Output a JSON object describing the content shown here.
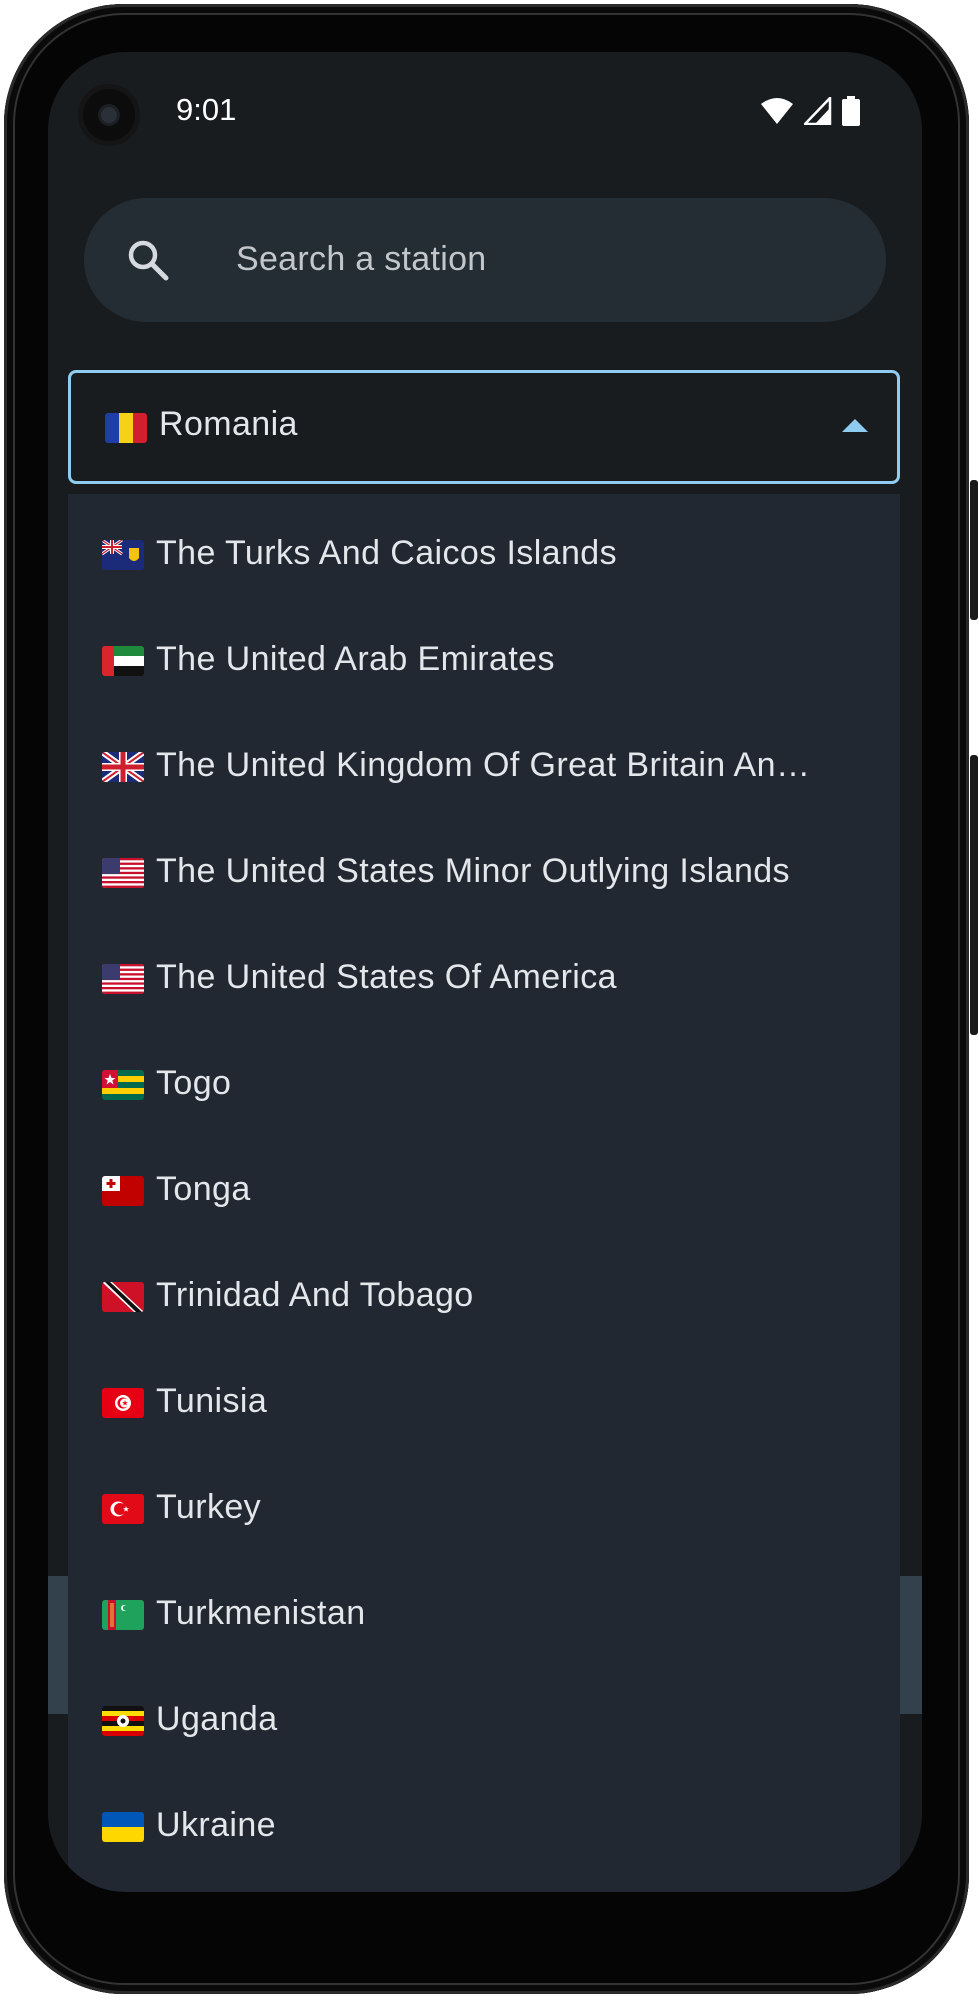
{
  "status_bar": {
    "time": "9:01",
    "icons": [
      "wifi-icon",
      "cellular-signal-icon",
      "battery-icon"
    ]
  },
  "search": {
    "placeholder": "Search a station",
    "icon": "search-icon"
  },
  "country_select": {
    "selected": "Romania",
    "selected_flag": "flag-romania-icon",
    "state": "expanded",
    "accent_color": "#8fcdf0"
  },
  "dropdown": {
    "items": [
      {
        "label": "The Turks And Caicos Islands",
        "flag": "flag-turks-caicos-icon"
      },
      {
        "label": "The United Arab Emirates",
        "flag": "flag-uae-icon"
      },
      {
        "label": "The United Kingdom Of Great Britain An…",
        "flag": "flag-uk-icon"
      },
      {
        "label": "The United States Minor Outlying Islands",
        "flag": "flag-us-minor-islands-icon"
      },
      {
        "label": "The United States Of America",
        "flag": "flag-usa-icon"
      },
      {
        "label": "Togo",
        "flag": "flag-togo-icon"
      },
      {
        "label": "Tonga",
        "flag": "flag-tonga-icon"
      },
      {
        "label": "Trinidad And Tobago",
        "flag": "flag-trinidad-tobago-icon"
      },
      {
        "label": "Tunisia",
        "flag": "flag-tunisia-icon"
      },
      {
        "label": "Turkey",
        "flag": "flag-turkey-icon"
      },
      {
        "label": "Turkmenistan",
        "flag": "flag-turkmenistan-icon"
      },
      {
        "label": "Uganda",
        "flag": "flag-uganda-icon"
      },
      {
        "label": "Ukraine",
        "flag": "flag-ukraine-icon"
      }
    ]
  },
  "colors": {
    "screen_background": "#191c1f",
    "search_background": "#232d33",
    "menu_background": "#222831",
    "text": "#e3e6ea"
  }
}
